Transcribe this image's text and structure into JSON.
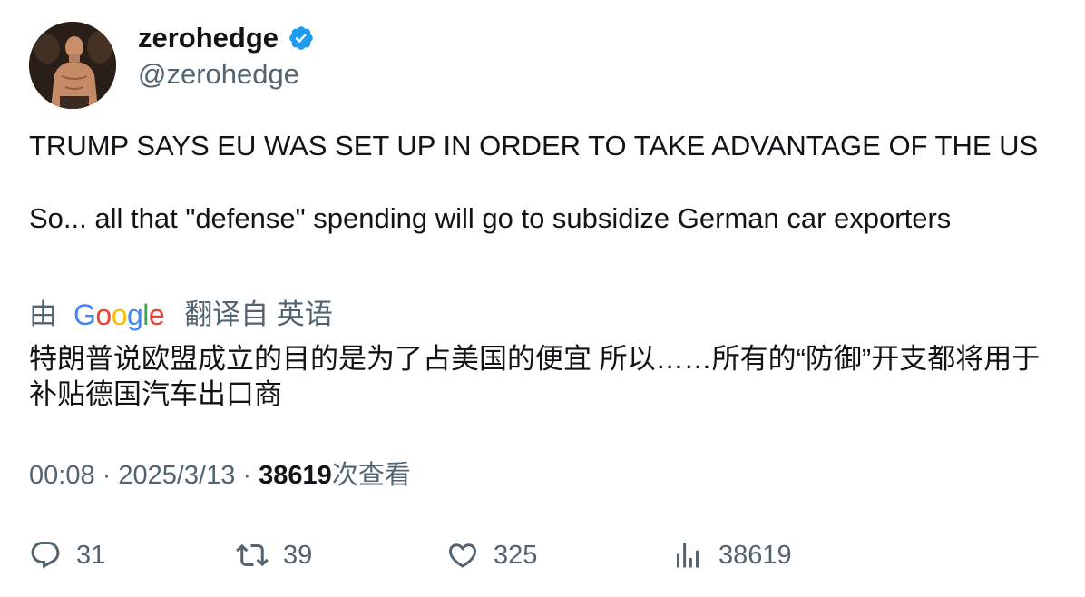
{
  "author": {
    "display_name": "zerohedge",
    "handle": "@zerohedge",
    "verified_color": "#1d9bf0",
    "avatar_icon": "avatar-photo"
  },
  "tweet": {
    "line1": "TRUMP SAYS EU WAS SET UP IN ORDER TO TAKE ADVANTAGE OF THE US",
    "line2": "So... all that \"defense\" spending will go to subsidize German car exporters"
  },
  "translation": {
    "by_label": "由",
    "provider": "Google",
    "translated_from": "翻译自 英语",
    "text": "特朗普说欧盟成立的目的是为了占美国的便宜 所以……所有的“防御”开支都将用于补贴德国汽车出口商"
  },
  "meta": {
    "time": "00:08",
    "separator1": "·",
    "date": "2025/3/13",
    "separator2": "·",
    "views_count": "38619",
    "views_label": "次查看"
  },
  "actions": {
    "replies": "31",
    "retweets": "39",
    "likes": "325",
    "views": "38619"
  },
  "colors": {
    "text": "#0f1419",
    "secondary": "#536471",
    "google_blue": "#4285F4",
    "google_red": "#EA4335",
    "google_yellow": "#FBBC05",
    "google_green": "#34A853"
  }
}
